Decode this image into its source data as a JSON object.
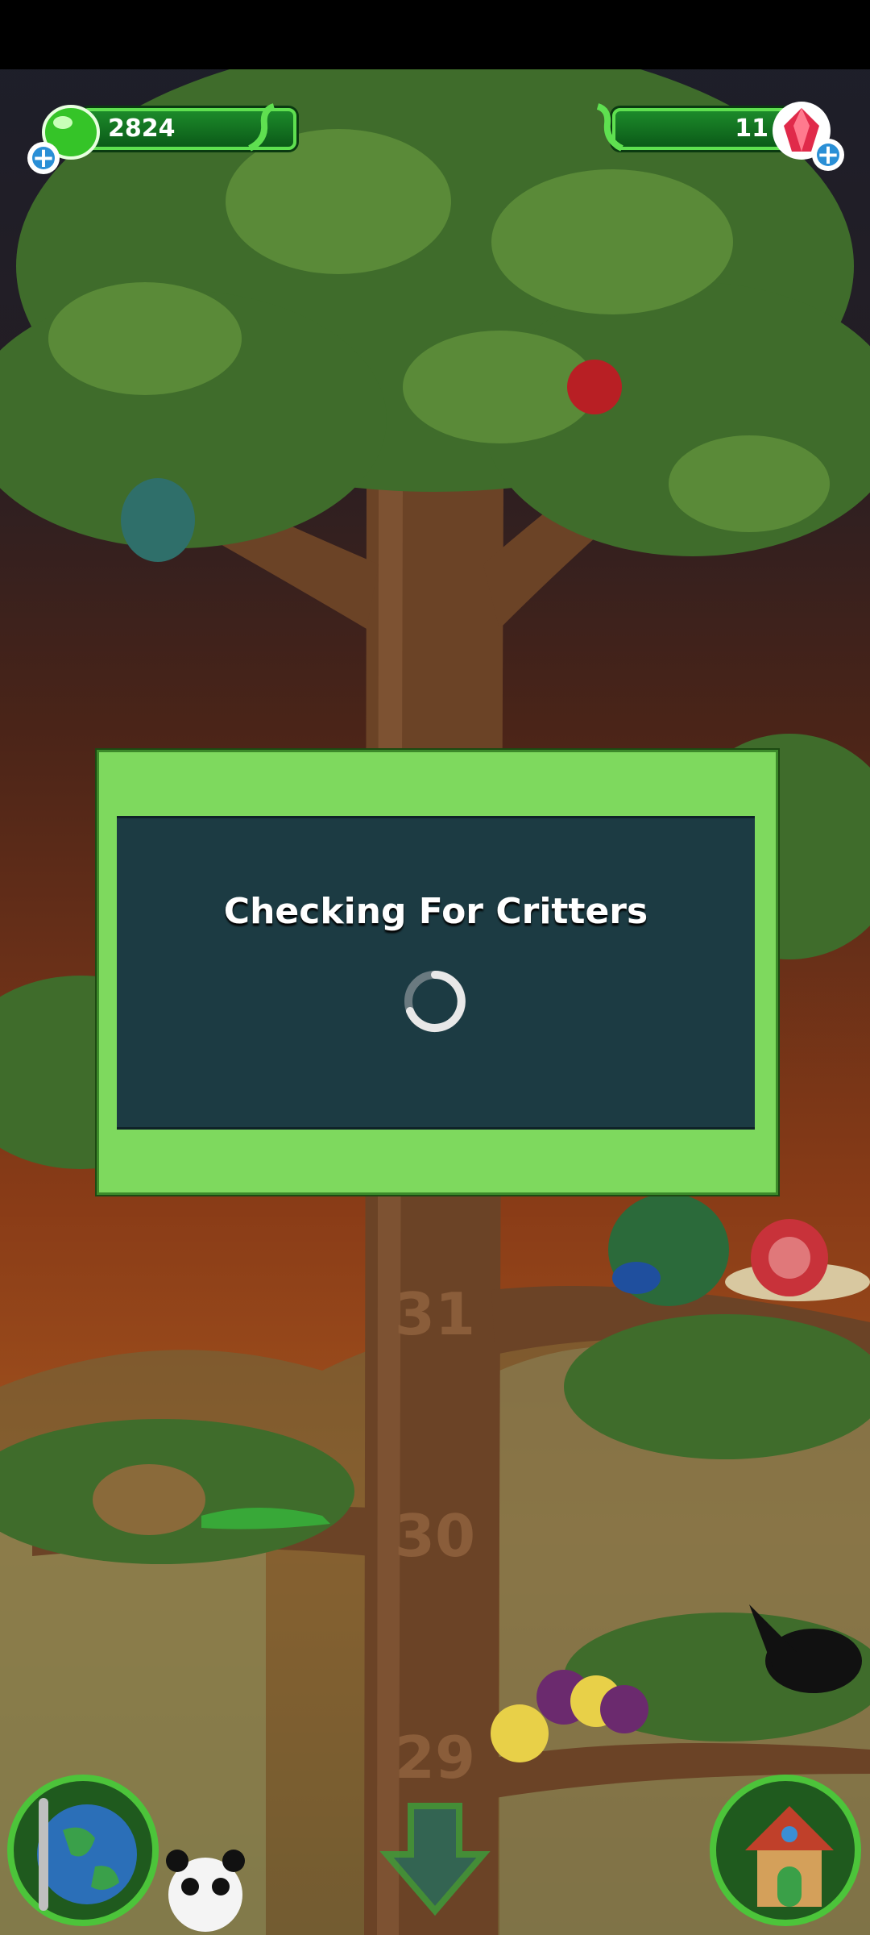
{
  "hud": {
    "gel_count": "2824",
    "gem_count": "11",
    "add_gel_symbol": "+",
    "add_gem_symbol": "+"
  },
  "dialog": {
    "title": "Checking For Critters"
  },
  "tree": {
    "level_markers": [
      "31",
      "30",
      "29"
    ]
  },
  "colors": {
    "hud_bar": "#1c8a2a",
    "dialog_frame": "#7ed95e",
    "dialog_body": "#1c3b43"
  },
  "icons": [
    "gel-icon",
    "gem-icon",
    "lizard-icon",
    "globe-icon",
    "house-icon",
    "down-arrow-icon",
    "loading-spinner-icon"
  ]
}
